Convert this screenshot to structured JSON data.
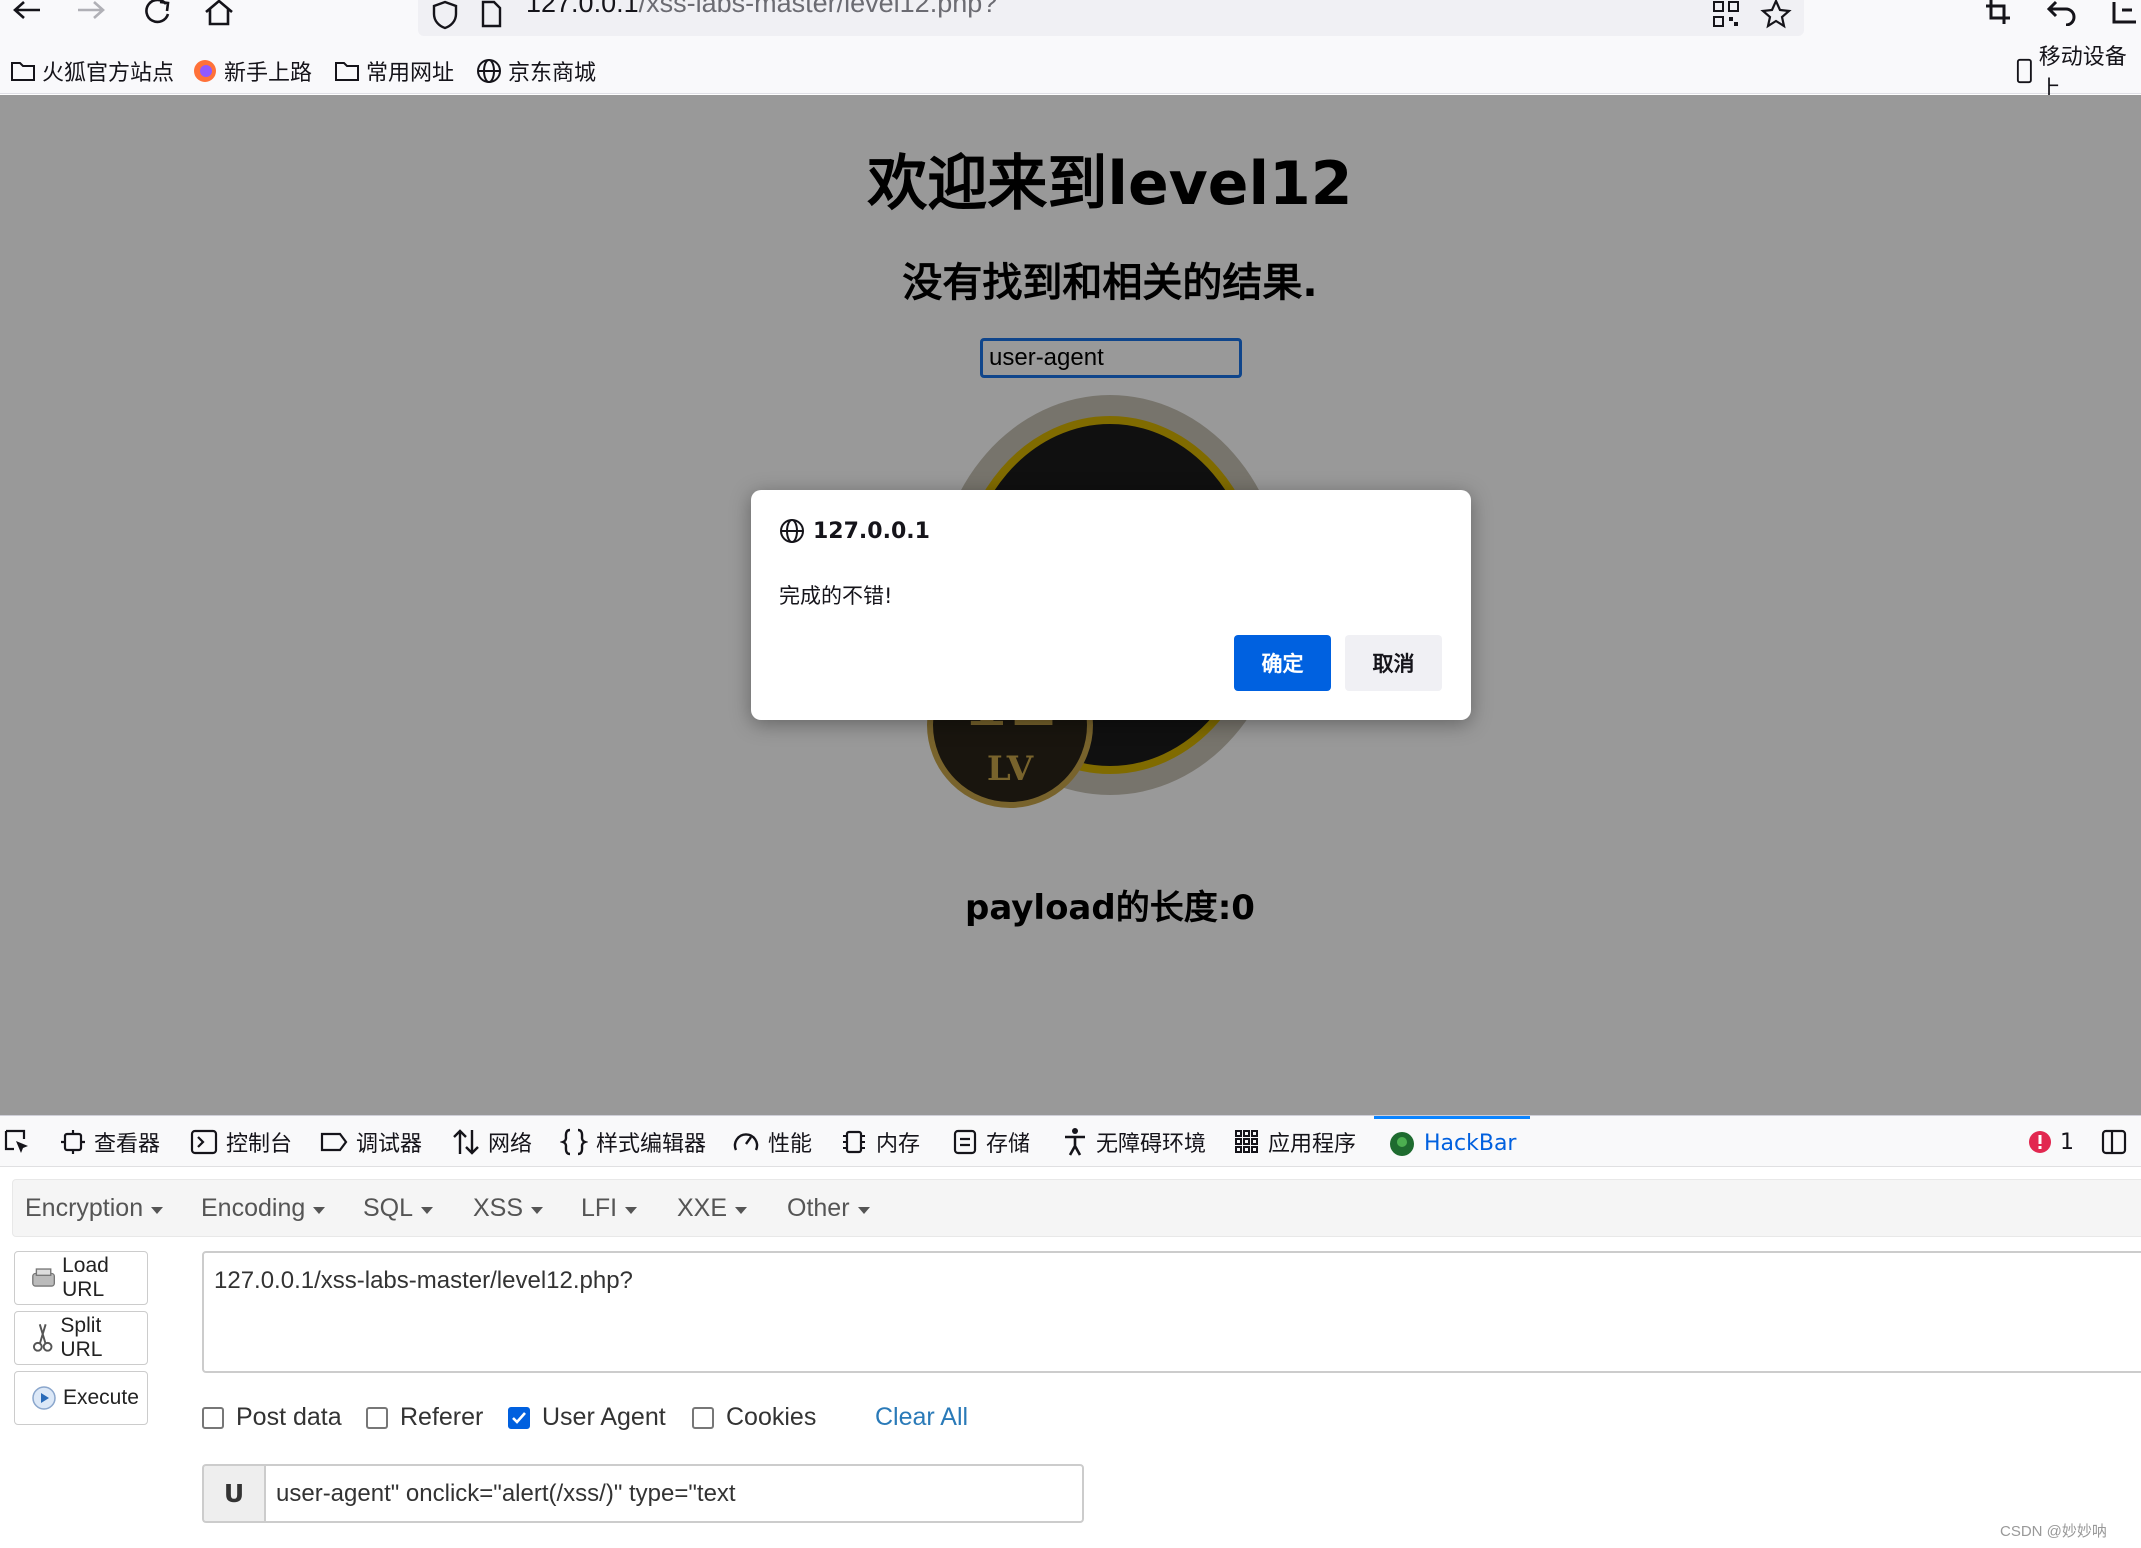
{
  "browser": {
    "url_host": "127.0.0.1",
    "url_path": "/xss-labs-master/level12.php?",
    "bookmarks": [
      "火狐官方站点",
      "新手上路",
      "常用网址",
      "京东商城"
    ],
    "mobile_bookmarks": "移动设备上"
  },
  "page": {
    "heading": "欢迎来到level12",
    "subheading": "没有找到和相关的结果.",
    "search_value": "user-agent",
    "medal_text": "12",
    "medal_sub": "LV",
    "payload_length": "payload的长度:0"
  },
  "dialog": {
    "origin": "127.0.0.1",
    "message": "完成的不错!",
    "ok_label": "确定",
    "cancel_label": "取消"
  },
  "devtools": {
    "tabs": [
      "查看器",
      "控制台",
      "调试器",
      "网络",
      "样式编辑器",
      "性能",
      "内存",
      "存储",
      "无障碍环境",
      "应用程序",
      "HackBar"
    ],
    "error_count": "1"
  },
  "hackbar": {
    "menus": [
      "Encryption",
      "Encoding",
      "SQL",
      "XSS",
      "LFI",
      "XXE",
      "Other"
    ],
    "buttons": [
      "Load URL",
      "Split URL",
      "Execute"
    ],
    "url_value": "127.0.0.1/xss-labs-master/level12.php?",
    "checkboxes": [
      {
        "label": "Post data",
        "checked": false
      },
      {
        "label": "Referer",
        "checked": false
      },
      {
        "label": "User Agent",
        "checked": true
      },
      {
        "label": "Cookies",
        "checked": false
      }
    ],
    "clear_all": "Clear All",
    "ua_prefix": "U",
    "ua_value": "user-agent\" onclick=\"alert(/xss/)\" type=\"text"
  },
  "watermark": "CSDN @妙妙呐",
  "colors": {
    "accent": "#0061e0",
    "overlay": "rgba(0,0,0,0.40)",
    "hackbar_link": "#2a7ab8"
  }
}
